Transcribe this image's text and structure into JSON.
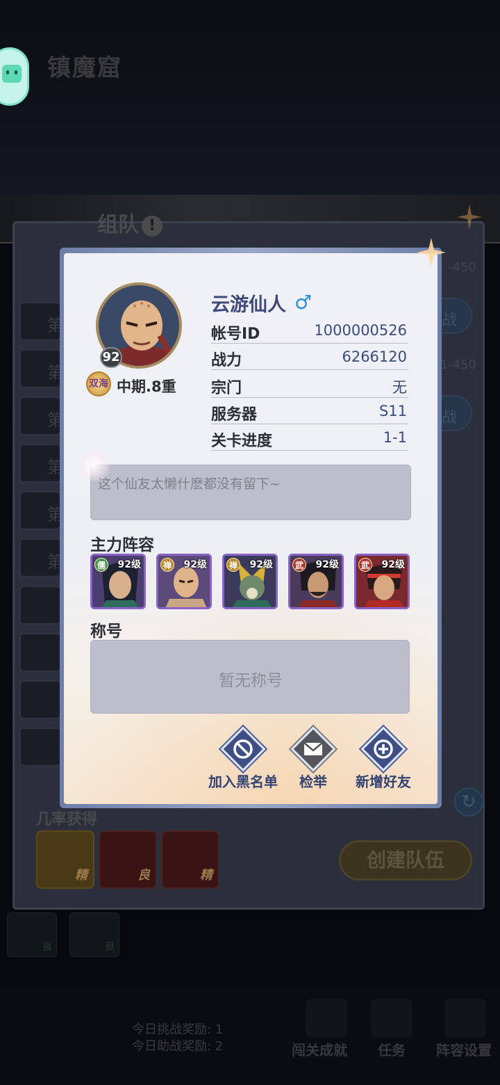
{
  "background": {
    "title": "镇魔窟",
    "team_title": "组队",
    "row_label": "第",
    "ranges": [
      "-450",
      "1-450"
    ],
    "btn_label": "战",
    "chance_label": "几率获得",
    "rewards": [
      {
        "tag": "精",
        "tone": "gold"
      },
      {
        "tag": "良",
        "tone": "red"
      },
      {
        "tag": "精",
        "tone": "red"
      }
    ],
    "bottom_rewards": [
      {
        "tag": "良"
      },
      {
        "tag": "良"
      }
    ],
    "create_team_label": "创建队伍",
    "daily_challenge": "今日挑战奖励: 1",
    "daily_assist": "今日助战奖励: 2",
    "nav": [
      "闯关成就",
      "任务",
      "阵容设置"
    ]
  },
  "profile": {
    "avatar_level": "92",
    "realm_icon": "双海",
    "realm": "中期.8重",
    "name": "云游仙人",
    "gender_icon": "♂",
    "rows": [
      {
        "key": "帐号ID",
        "value": "1000000526"
      },
      {
        "key": "战力",
        "value": "6266120"
      },
      {
        "key": "宗门",
        "value": "无"
      },
      {
        "key": "服务器",
        "value": "S11"
      },
      {
        "key": "关卡进度",
        "value": "1-1"
      }
    ],
    "signature": "这个仙友太懒什麽都没有留下~"
  },
  "lineup": {
    "title": "主力阵容",
    "heroes": [
      {
        "type": "儒",
        "level": "92级",
        "type_color": "#3f9a4a"
      },
      {
        "type": "禅",
        "level": "92级",
        "type_color": "#b98a2c"
      },
      {
        "type": "禅",
        "level": "92级",
        "type_color": "#b98a2c"
      },
      {
        "type": "武",
        "level": "92级",
        "type_color": "#b3372e"
      },
      {
        "type": "武",
        "level": "92级",
        "type_color": "#b3372e"
      }
    ]
  },
  "titles": {
    "title": "称号",
    "empty": "暂无称号"
  },
  "actions": [
    {
      "label": "加入黑名单",
      "icon": "block-icon"
    },
    {
      "label": "检举",
      "icon": "mail-icon"
    },
    {
      "label": "新增好友",
      "icon": "add-friend-icon"
    }
  ],
  "colors": {
    "accent": "#3e4a78",
    "panel_bg": "#eeeff5",
    "hero_border": "#8a63c7"
  }
}
